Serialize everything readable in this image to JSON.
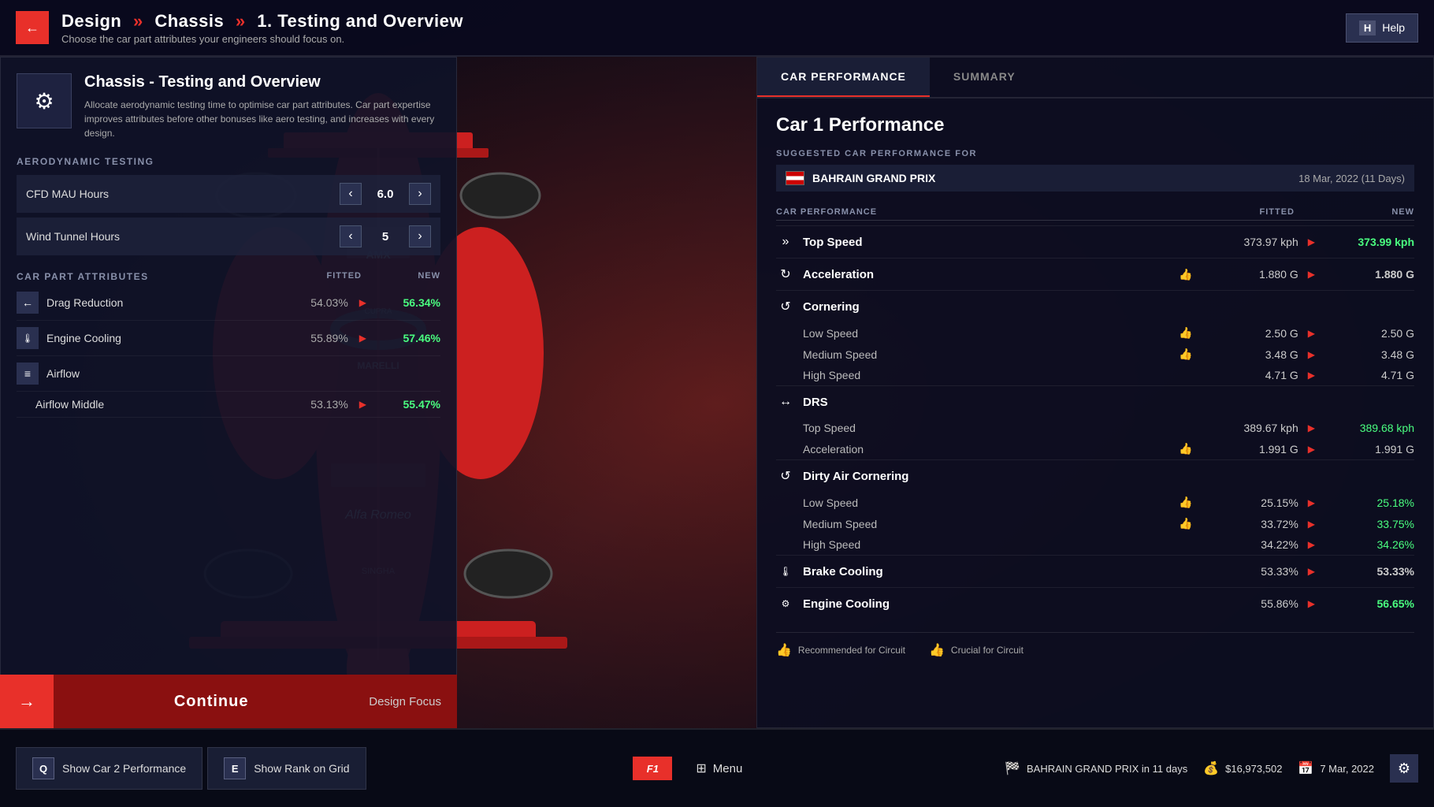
{
  "header": {
    "back_label": "←",
    "breadcrumb": "Design » Chassis » 1. Testing and Overview",
    "breadcrumb_parts": [
      "Design",
      "Chassis",
      "1. Testing and Overview"
    ],
    "subtitle": "Choose the car part attributes your engineers should focus on.",
    "help_key": "H",
    "help_label": "Help"
  },
  "chassis_panel": {
    "icon": "⚙",
    "title": "Chassis - Testing and Overview",
    "description": "Allocate aerodynamic testing time to optimise car part attributes. Car part expertise improves attributes before other bonuses like aero testing, and increases with every design.",
    "aero_section_label": "AERODYNAMIC TESTING",
    "spinners": [
      {
        "label": "CFD MAU Hours",
        "value": "6.0"
      },
      {
        "label": "Wind Tunnel Hours",
        "value": "5"
      }
    ],
    "attributes_label": "CAR PART ATTRIBUTES",
    "fitted_col": "FITTED",
    "new_col": "NEW",
    "attributes": [
      {
        "icon": "←",
        "label": "Drag Reduction",
        "fitted": "54.03%",
        "arrow": "▶",
        "new_val": "56.34%",
        "improved": true,
        "indent": false
      },
      {
        "icon": "🌡",
        "label": "Engine Cooling",
        "fitted": "55.89%",
        "arrow": "▶",
        "new_val": "57.46%",
        "improved": true,
        "indent": false
      },
      {
        "icon": "≡",
        "label": "Airflow",
        "fitted": "",
        "arrow": "",
        "new_val": "",
        "improved": false,
        "indent": false
      },
      {
        "icon": "",
        "label": "Airflow Middle",
        "fitted": "53.13%",
        "arrow": "▶",
        "new_val": "55.47%",
        "improved": true,
        "indent": true
      }
    ],
    "continue_label": "Continue",
    "design_focus_label": "Design Focus"
  },
  "right_panel": {
    "tabs": [
      {
        "label": "CAR PERFORMANCE",
        "active": true
      },
      {
        "label": "SUMMARY",
        "active": false
      }
    ],
    "car_perf_title": "Car 1 Performance",
    "suggested_label": "SUGGESTED CAR PERFORMANCE FOR",
    "grand_prix": {
      "name": "BAHRAIN GRAND PRIX",
      "date": "18 Mar, 2022 (11 Days)"
    },
    "car_perf_label": "CAR PERFORMANCE",
    "fitted_col": "FITTED",
    "new_col": "NEW",
    "sections": [
      {
        "icon": "»",
        "label": "Top Speed",
        "fitted": "373.97 kph",
        "new_val": "373.99 kph",
        "improved": true,
        "subs": []
      },
      {
        "icon": "↻",
        "label": "Acceleration",
        "fitted": "1.880 G",
        "new_val": "1.880 G",
        "improved": false,
        "thumb": true,
        "subs": []
      },
      {
        "icon": "↺",
        "label": "Cornering",
        "fitted": "",
        "new_val": "",
        "improved": false,
        "subs": [
          {
            "label": "Low Speed",
            "thumb": true,
            "fitted": "2.50 G",
            "new_val": "2.50 G",
            "improved": false
          },
          {
            "label": "Medium Speed",
            "thumb": true,
            "fitted": "3.48 G",
            "new_val": "3.48 G",
            "improved": false
          },
          {
            "label": "High Speed",
            "thumb": false,
            "fitted": "4.71 G",
            "new_val": "4.71 G",
            "improved": false
          }
        ]
      },
      {
        "icon": "↔",
        "label": "DRS",
        "fitted": "",
        "new_val": "",
        "improved": false,
        "subs": [
          {
            "label": "Top Speed",
            "thumb": false,
            "fitted": "389.67 kph",
            "new_val": "389.68 kph",
            "improved": true
          },
          {
            "label": "Acceleration",
            "thumb": true,
            "fitted": "1.991 G",
            "new_val": "1.991 G",
            "improved": false
          }
        ]
      },
      {
        "icon": "↺",
        "label": "Dirty Air Cornering",
        "fitted": "",
        "new_val": "",
        "improved": false,
        "subs": [
          {
            "label": "Low Speed",
            "thumb": true,
            "fitted": "25.15%",
            "new_val": "25.18%",
            "improved": true
          },
          {
            "label": "Medium Speed",
            "thumb": true,
            "fitted": "33.72%",
            "new_val": "33.75%",
            "improved": true
          },
          {
            "label": "High Speed",
            "thumb": false,
            "fitted": "34.22%",
            "new_val": "34.26%",
            "improved": true
          }
        ]
      },
      {
        "icon": "🌡",
        "label": "Brake Cooling",
        "fitted": "53.33%",
        "new_val": "53.33%",
        "improved": false,
        "subs": []
      },
      {
        "icon": "⚙",
        "label": "Engine Cooling",
        "fitted": "55.86%",
        "new_val": "56.65%",
        "improved": true,
        "subs": []
      }
    ],
    "legend": [
      {
        "icon": "👍",
        "label": "Recommended for Circuit"
      },
      {
        "icon": "👍",
        "label": "Crucial for Circuit",
        "green": true
      }
    ]
  },
  "bottom_bar": {
    "shortcuts": [
      {
        "key": "Q",
        "label": "Show Car 2 Performance"
      },
      {
        "key": "E",
        "label": "Show Rank on Grid"
      }
    ],
    "f1_logo": "F1",
    "menu_label": "Menu",
    "stats": [
      {
        "icon": "🏁",
        "label": "BAHRAIN GRAND PRIX in 11 days"
      },
      {
        "icon": "💰",
        "label": "$16,973,502"
      },
      {
        "icon": "📅",
        "label": "7 Mar, 2022"
      }
    ]
  }
}
